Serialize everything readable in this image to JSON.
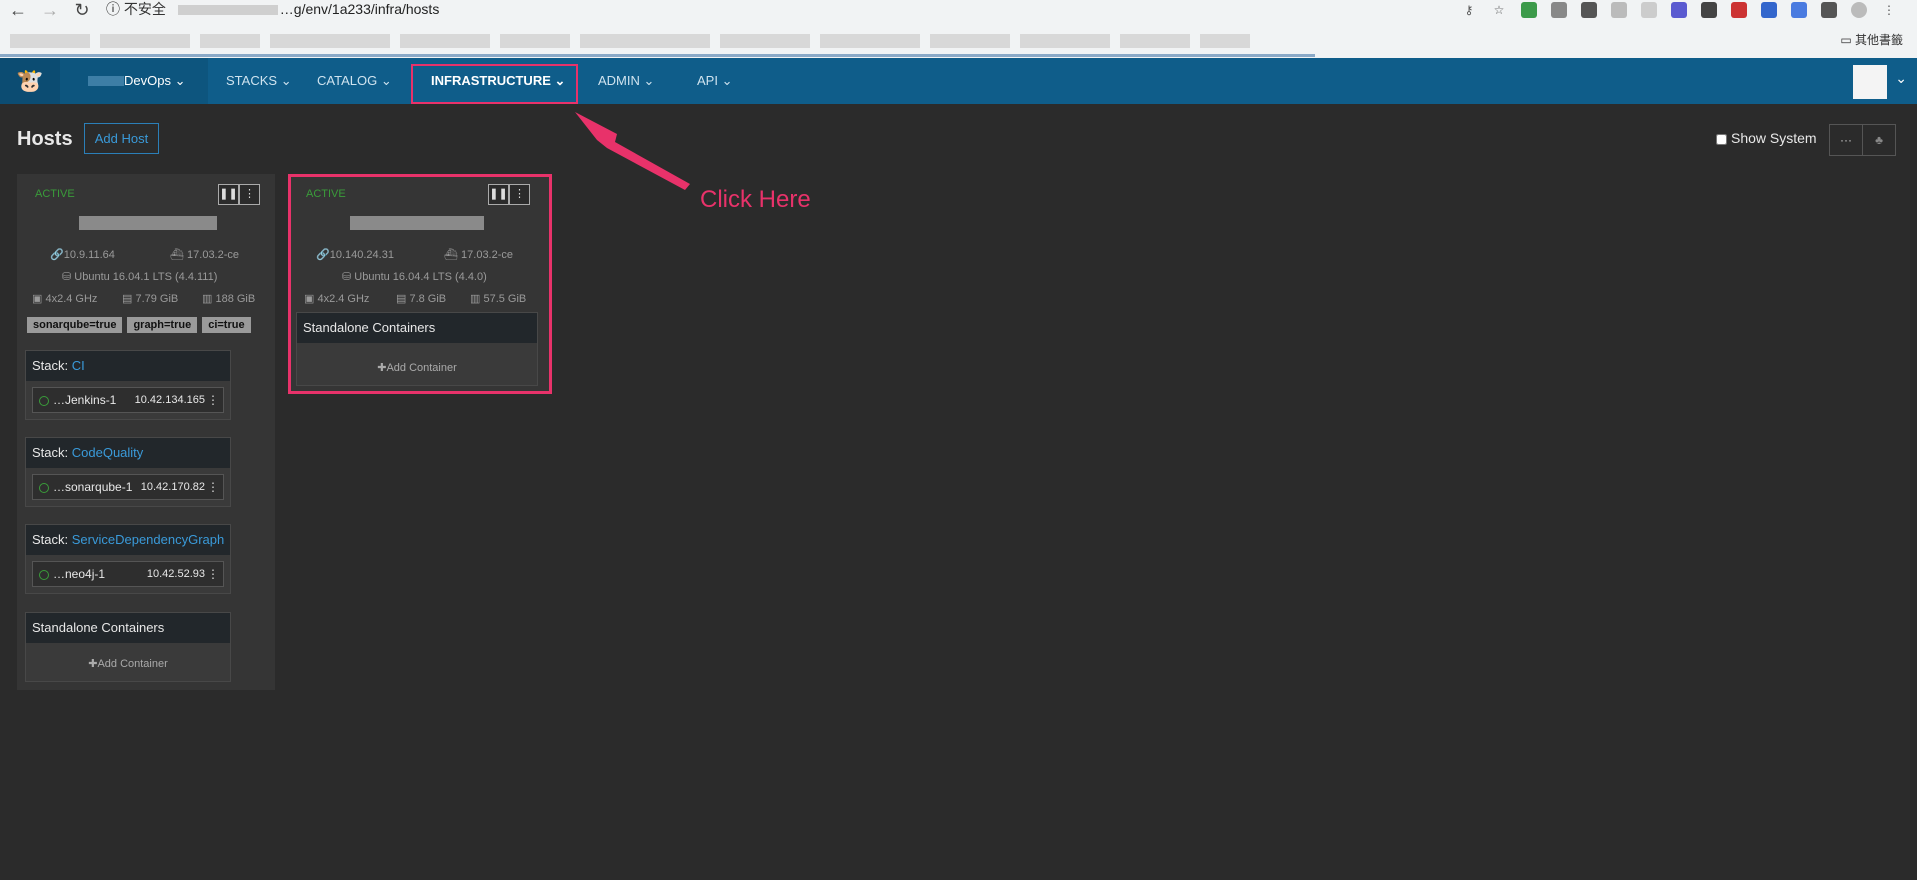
{
  "browser": {
    "security": "不安全",
    "url": "…g/env/1a233/infra/hosts",
    "bookmarks_other": "其他書籤"
  },
  "nav": {
    "env_label": "DevOps",
    "items": [
      "STACKS",
      "CATALOG",
      "INFRASTRUCTURE",
      "ADMIN",
      "API"
    ],
    "active": "INFRASTRUCTURE"
  },
  "page": {
    "title": "Hosts",
    "add_host": "Add Host",
    "show_system": "Show System"
  },
  "hosts": [
    {
      "state": "ACTIVE",
      "ip": "10.9.11.64",
      "docker": "17.03.2-ce",
      "os": "Ubuntu 16.04.1 LTS (4.4.111)",
      "cpu": "4x2.4 GHz",
      "ram": "7.79 GiB",
      "disk": "188 GiB",
      "labels": [
        "sonarqube=true",
        "graph=true",
        "ci=true"
      ],
      "stacks": [
        {
          "prefix": "Stack:",
          "name": "CI",
          "container": "…Jenkins-1",
          "ip": "10.42.134.165"
        },
        {
          "prefix": "Stack:",
          "name": "CodeQuality",
          "container": "…sonarqube-1",
          "ip": "10.42.170.82"
        },
        {
          "prefix": "Stack:",
          "name": "ServiceDependencyGraph",
          "container": "…neo4j-1",
          "ip": "10.42.52.93"
        }
      ],
      "standalone": "Standalone Containers",
      "add_container": "Add Container"
    },
    {
      "state": "ACTIVE",
      "ip": "10.140.24.31",
      "docker": "17.03.2-ce",
      "os": "Ubuntu 16.04.4 LTS (4.4.0)",
      "cpu": "4x2.4 GHz",
      "ram": "7.8 GiB",
      "disk": "57.5 GiB",
      "standalone": "Standalone Containers",
      "add_container": "Add Container"
    }
  ],
  "annotation": {
    "text": "Click Here",
    "color": "#e8326a"
  }
}
